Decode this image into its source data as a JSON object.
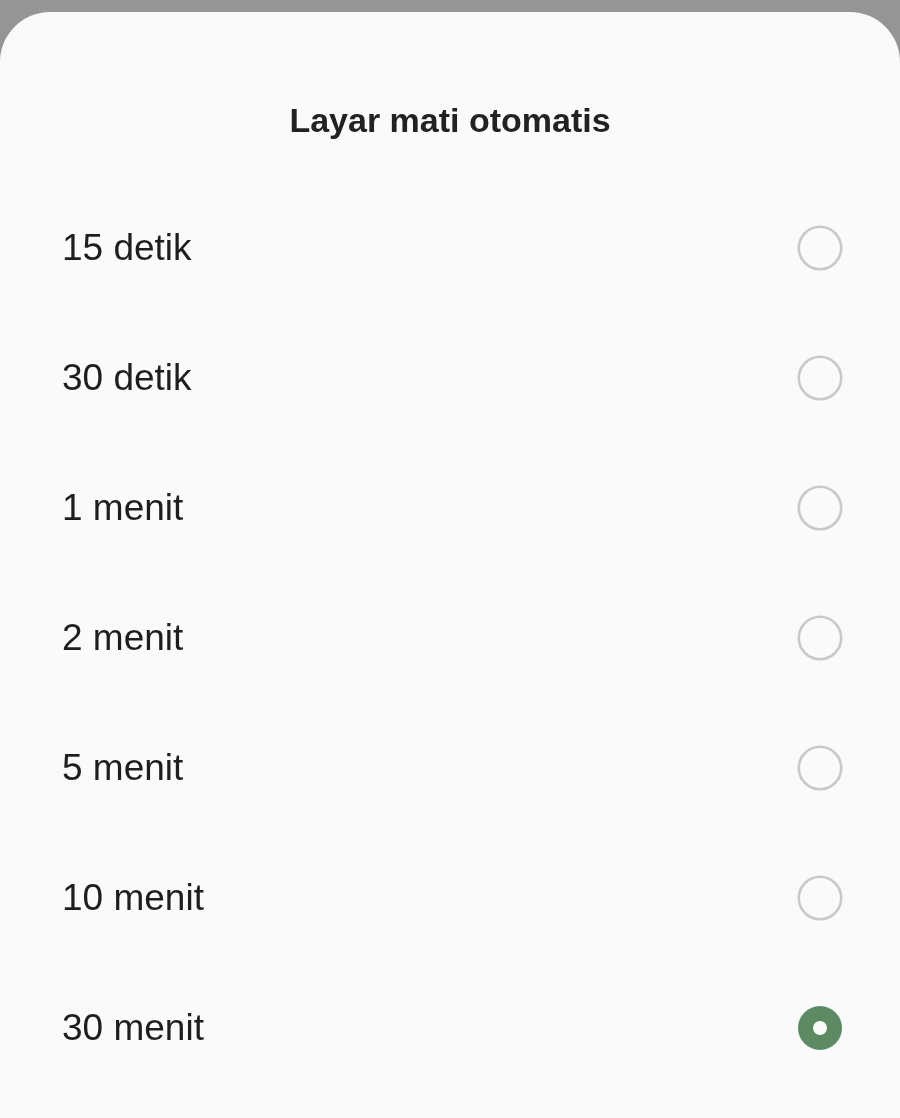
{
  "dialog": {
    "title": "Layar mati otomatis"
  },
  "options": [
    {
      "label": "15 detik",
      "selected": false
    },
    {
      "label": "30 detik",
      "selected": false
    },
    {
      "label": "1 menit",
      "selected": false
    },
    {
      "label": "2 menit",
      "selected": false
    },
    {
      "label": "5 menit",
      "selected": false
    },
    {
      "label": "10 menit",
      "selected": false
    },
    {
      "label": "30 menit",
      "selected": true
    }
  ]
}
